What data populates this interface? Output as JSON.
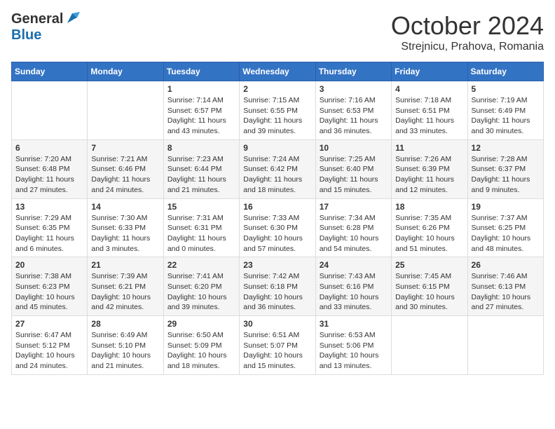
{
  "header": {
    "logo_general": "General",
    "logo_blue": "Blue",
    "month_title": "October 2024",
    "location": "Strejnicu, Prahova, Romania"
  },
  "days_of_week": [
    "Sunday",
    "Monday",
    "Tuesday",
    "Wednesday",
    "Thursday",
    "Friday",
    "Saturday"
  ],
  "weeks": [
    [
      {
        "day": "",
        "info": ""
      },
      {
        "day": "",
        "info": ""
      },
      {
        "day": "1",
        "info": "Sunrise: 7:14 AM\nSunset: 6:57 PM\nDaylight: 11 hours and 43 minutes."
      },
      {
        "day": "2",
        "info": "Sunrise: 7:15 AM\nSunset: 6:55 PM\nDaylight: 11 hours and 39 minutes."
      },
      {
        "day": "3",
        "info": "Sunrise: 7:16 AM\nSunset: 6:53 PM\nDaylight: 11 hours and 36 minutes."
      },
      {
        "day": "4",
        "info": "Sunrise: 7:18 AM\nSunset: 6:51 PM\nDaylight: 11 hours and 33 minutes."
      },
      {
        "day": "5",
        "info": "Sunrise: 7:19 AM\nSunset: 6:49 PM\nDaylight: 11 hours and 30 minutes."
      }
    ],
    [
      {
        "day": "6",
        "info": "Sunrise: 7:20 AM\nSunset: 6:48 PM\nDaylight: 11 hours and 27 minutes."
      },
      {
        "day": "7",
        "info": "Sunrise: 7:21 AM\nSunset: 6:46 PM\nDaylight: 11 hours and 24 minutes."
      },
      {
        "day": "8",
        "info": "Sunrise: 7:23 AM\nSunset: 6:44 PM\nDaylight: 11 hours and 21 minutes."
      },
      {
        "day": "9",
        "info": "Sunrise: 7:24 AM\nSunset: 6:42 PM\nDaylight: 11 hours and 18 minutes."
      },
      {
        "day": "10",
        "info": "Sunrise: 7:25 AM\nSunset: 6:40 PM\nDaylight: 11 hours and 15 minutes."
      },
      {
        "day": "11",
        "info": "Sunrise: 7:26 AM\nSunset: 6:39 PM\nDaylight: 11 hours and 12 minutes."
      },
      {
        "day": "12",
        "info": "Sunrise: 7:28 AM\nSunset: 6:37 PM\nDaylight: 11 hours and 9 minutes."
      }
    ],
    [
      {
        "day": "13",
        "info": "Sunrise: 7:29 AM\nSunset: 6:35 PM\nDaylight: 11 hours and 6 minutes."
      },
      {
        "day": "14",
        "info": "Sunrise: 7:30 AM\nSunset: 6:33 PM\nDaylight: 11 hours and 3 minutes."
      },
      {
        "day": "15",
        "info": "Sunrise: 7:31 AM\nSunset: 6:31 PM\nDaylight: 11 hours and 0 minutes."
      },
      {
        "day": "16",
        "info": "Sunrise: 7:33 AM\nSunset: 6:30 PM\nDaylight: 10 hours and 57 minutes."
      },
      {
        "day": "17",
        "info": "Sunrise: 7:34 AM\nSunset: 6:28 PM\nDaylight: 10 hours and 54 minutes."
      },
      {
        "day": "18",
        "info": "Sunrise: 7:35 AM\nSunset: 6:26 PM\nDaylight: 10 hours and 51 minutes."
      },
      {
        "day": "19",
        "info": "Sunrise: 7:37 AM\nSunset: 6:25 PM\nDaylight: 10 hours and 48 minutes."
      }
    ],
    [
      {
        "day": "20",
        "info": "Sunrise: 7:38 AM\nSunset: 6:23 PM\nDaylight: 10 hours and 45 minutes."
      },
      {
        "day": "21",
        "info": "Sunrise: 7:39 AM\nSunset: 6:21 PM\nDaylight: 10 hours and 42 minutes."
      },
      {
        "day": "22",
        "info": "Sunrise: 7:41 AM\nSunset: 6:20 PM\nDaylight: 10 hours and 39 minutes."
      },
      {
        "day": "23",
        "info": "Sunrise: 7:42 AM\nSunset: 6:18 PM\nDaylight: 10 hours and 36 minutes."
      },
      {
        "day": "24",
        "info": "Sunrise: 7:43 AM\nSunset: 6:16 PM\nDaylight: 10 hours and 33 minutes."
      },
      {
        "day": "25",
        "info": "Sunrise: 7:45 AM\nSunset: 6:15 PM\nDaylight: 10 hours and 30 minutes."
      },
      {
        "day": "26",
        "info": "Sunrise: 7:46 AM\nSunset: 6:13 PM\nDaylight: 10 hours and 27 minutes."
      }
    ],
    [
      {
        "day": "27",
        "info": "Sunrise: 6:47 AM\nSunset: 5:12 PM\nDaylight: 10 hours and 24 minutes."
      },
      {
        "day": "28",
        "info": "Sunrise: 6:49 AM\nSunset: 5:10 PM\nDaylight: 10 hours and 21 minutes."
      },
      {
        "day": "29",
        "info": "Sunrise: 6:50 AM\nSunset: 5:09 PM\nDaylight: 10 hours and 18 minutes."
      },
      {
        "day": "30",
        "info": "Sunrise: 6:51 AM\nSunset: 5:07 PM\nDaylight: 10 hours and 15 minutes."
      },
      {
        "day": "31",
        "info": "Sunrise: 6:53 AM\nSunset: 5:06 PM\nDaylight: 10 hours and 13 minutes."
      },
      {
        "day": "",
        "info": ""
      },
      {
        "day": "",
        "info": ""
      }
    ]
  ]
}
